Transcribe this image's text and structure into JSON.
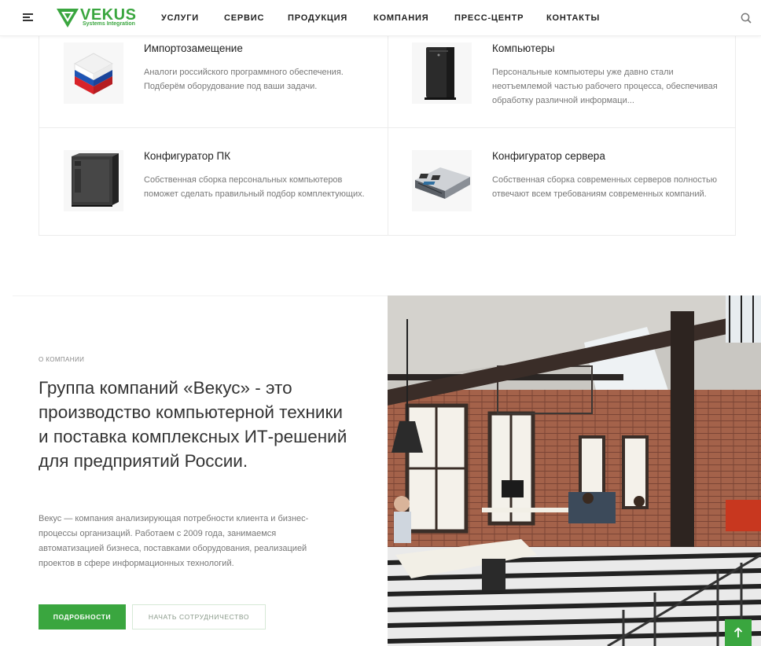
{
  "header": {
    "logo_text": "VEKUS",
    "logo_sub": "Systems Integration",
    "nav": [
      "УСЛУГИ",
      "СЕРВИС",
      "ПРОДУКЦИЯ",
      "КОМПАНИЯ",
      "ПРЕСС-ЦЕНТР",
      "КОНТАКТЫ"
    ],
    "icons": {
      "menu": "menu-icon",
      "search": "search-icon"
    }
  },
  "products": [
    {
      "title": "Импортозамещение",
      "desc": "Аналоги российского программного обеспечения. Подберём оборудование под ваши задачи.",
      "icon": "russian-flag-cube-image"
    },
    {
      "title": "Компьютеры",
      "desc": "Персональные компьютеры уже давно стали неотъемлемой частью рабочего процесса, обеспечивая обработку различной информаци...",
      "icon": "pc-tower-image"
    },
    {
      "title": "Конфигуратор ПК",
      "desc": "Собственная сборка персональных компьютеров поможет сделать правильный подбор комплектующих.",
      "icon": "pc-case-image"
    },
    {
      "title": "Конфигуратор сервера",
      "desc": "Собственная сборка современных серверов полностью отвечают всем требованиям современных компаний.",
      "icon": "rack-server-image"
    }
  ],
  "about": {
    "eyebrow": "О КОМПАНИИ",
    "headline": "Группа компаний «Векус» - это производство компьютерной техники и поставка комплексных ИТ-решений для предприятий России.",
    "body": "Векус — компания анализирующая потребности клиента и бизнес-процессы организаций. Работаем с 2009 года, занимаемся автоматизацией бизнеса, поставками оборудования, реализацией проектов в сфере информационных технологий.",
    "btn_primary": "ПОДРОБНОСТИ",
    "btn_secondary": "НАЧАТЬ СОТРУДНИЧЕСТВО"
  },
  "colors": {
    "accent": "#3aa63f",
    "text": "#333333",
    "muted": "#777777"
  }
}
